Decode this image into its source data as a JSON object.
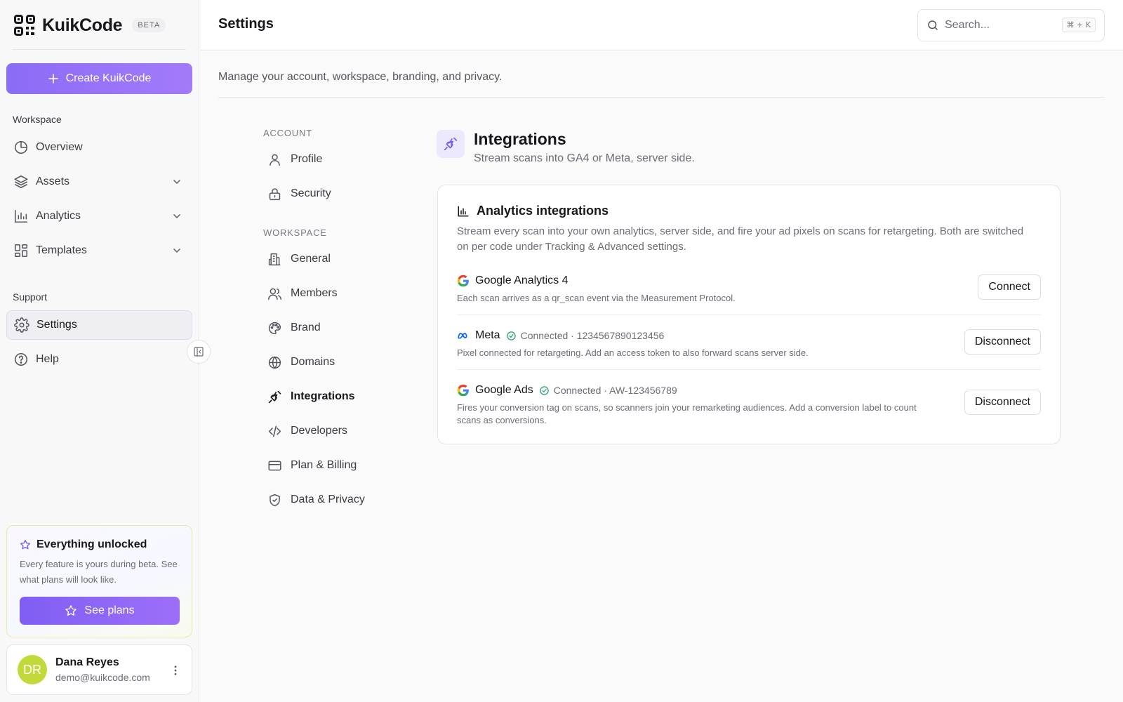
{
  "brand": {
    "name": "KuikCode",
    "badge": "BETA"
  },
  "sidebar": {
    "create_label": "Create KuikCode",
    "workspace_heading": "Workspace",
    "items": [
      {
        "label": "Overview"
      },
      {
        "label": "Assets"
      },
      {
        "label": "Analytics"
      },
      {
        "label": "Templates"
      }
    ],
    "support_heading": "Support",
    "support_items": [
      {
        "label": "Settings"
      },
      {
        "label": "Help"
      }
    ],
    "promo": {
      "title": "Everything unlocked",
      "text": "Every feature is yours during beta. See what plans will look like.",
      "button": "See plans"
    },
    "user": {
      "initials": "DR",
      "name": "Dana Reyes",
      "email": "demo@kuikcode.com"
    }
  },
  "header": {
    "title": "Settings",
    "search_placeholder": "Search...",
    "search_shortcut": "⌘ + K"
  },
  "main": {
    "subtitle": "Manage your account, workspace, branding, and privacy.",
    "nav": {
      "account_heading": "ACCOUNT",
      "account_items": [
        {
          "label": "Profile"
        },
        {
          "label": "Security"
        }
      ],
      "workspace_heading": "WORKSPACE",
      "workspace_items": [
        {
          "label": "General"
        },
        {
          "label": "Members"
        },
        {
          "label": "Brand"
        },
        {
          "label": "Domains"
        },
        {
          "label": "Integrations"
        },
        {
          "label": "Developers"
        },
        {
          "label": "Plan & Billing"
        },
        {
          "label": "Data & Privacy"
        }
      ]
    },
    "section": {
      "title": "Integrations",
      "subtitle": "Stream scans into GA4 or Meta, server side."
    },
    "card": {
      "title": "Analytics integrations",
      "description": "Stream every scan into your own analytics, server side, and fire your ad pixels on scans for retargeting. Both are switched on per code under Tracking & Advanced settings.",
      "integrations": [
        {
          "name": "Google Analytics 4",
          "status": "",
          "description": "Each scan arrives as a qr_scan event via the Measurement Protocol.",
          "action": "Connect"
        },
        {
          "name": "Meta",
          "status": "Connected · 1234567890123456",
          "description": "Pixel connected for retargeting. Add an access token to also forward scans server side.",
          "action": "Disconnect"
        },
        {
          "name": "Google Ads",
          "status": "Connected · AW-123456789",
          "description": "Fires your conversion tag on scans, so scanners join your remarketing audiences. Add a conversion label to count scans as conversions.",
          "action": "Disconnect"
        }
      ]
    }
  },
  "colors": {
    "accent": "#8b6cf6",
    "connected": "#22a06b",
    "avatar": "#c2d93a"
  }
}
